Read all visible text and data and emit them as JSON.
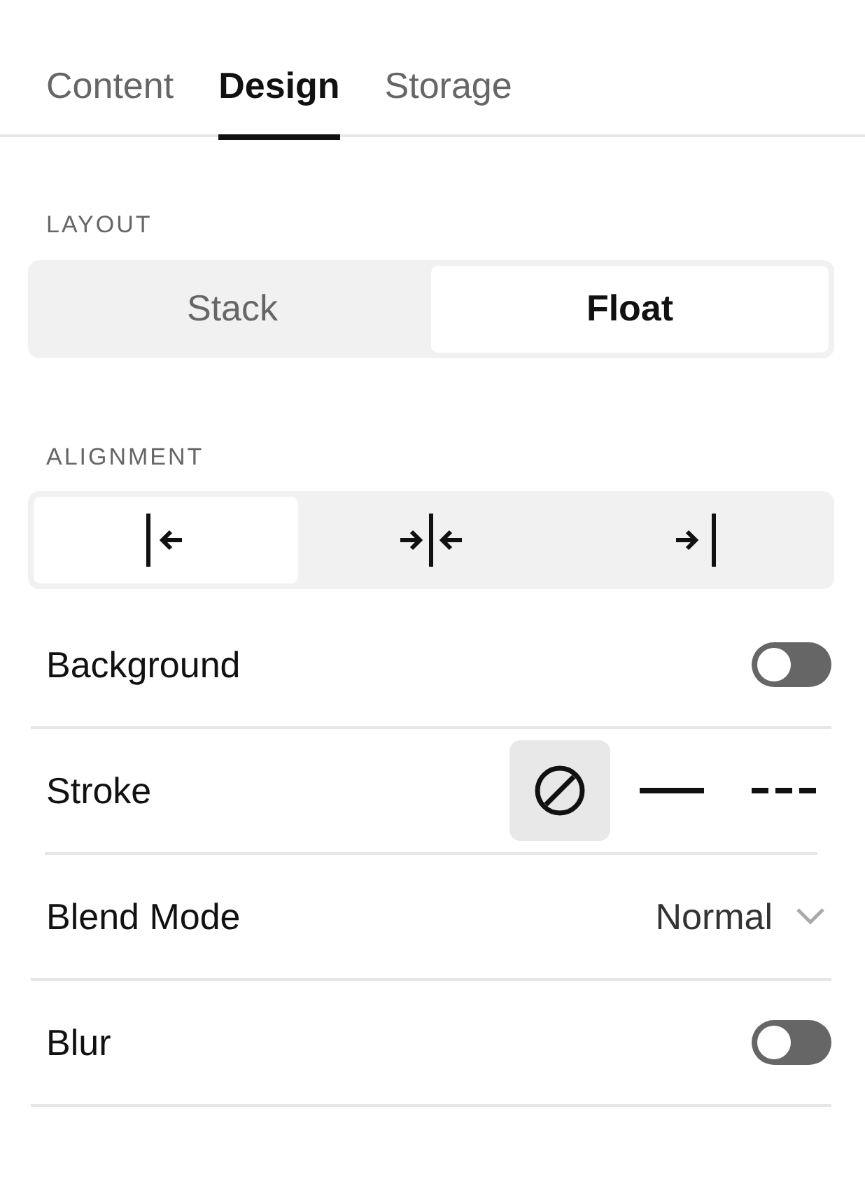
{
  "tabs": [
    {
      "label": "Content",
      "selected": false
    },
    {
      "label": "Design",
      "selected": true
    },
    {
      "label": "Storage",
      "selected": false
    }
  ],
  "layout": {
    "label": "LAYOUT",
    "options": [
      {
        "label": "Stack",
        "selected": false
      },
      {
        "label": "Float",
        "selected": true
      }
    ]
  },
  "alignment": {
    "label": "ALIGNMENT",
    "options": [
      {
        "kind": "left",
        "selected": true
      },
      {
        "kind": "center",
        "selected": false
      },
      {
        "kind": "right",
        "selected": false
      }
    ]
  },
  "rows": [
    {
      "kind": "toggle",
      "label": "Background",
      "on": false
    },
    {
      "kind": "stroke",
      "label": "Stroke",
      "options": [
        {
          "kind": "none",
          "selected": true
        },
        {
          "kind": "solid",
          "selected": false
        },
        {
          "kind": "dashed",
          "selected": false
        }
      ]
    },
    {
      "kind": "select",
      "label": "Blend Mode",
      "value": "Normal"
    },
    {
      "kind": "toggle",
      "label": "Blur",
      "on": false
    }
  ]
}
